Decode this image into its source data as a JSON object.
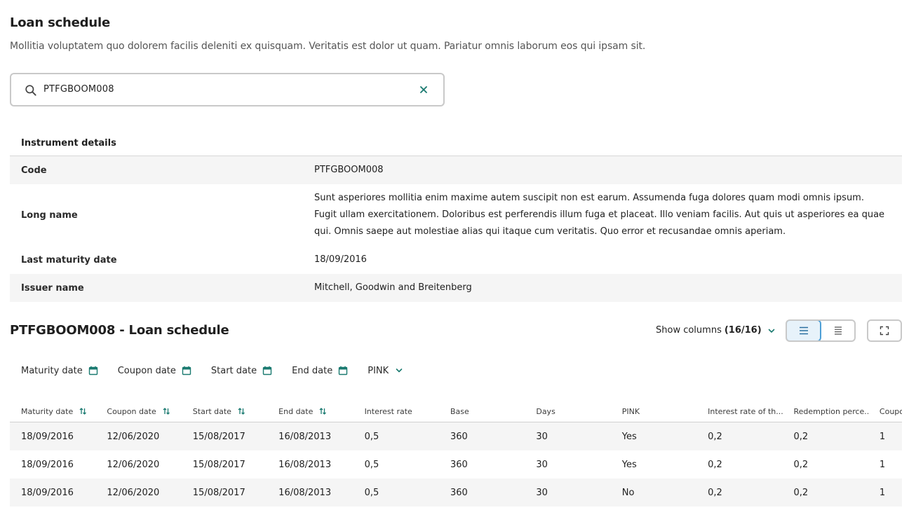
{
  "header": {
    "title": "Loan schedule",
    "description": "Mollitia voluptatem quo dolorem facilis deleniti ex quisquam. Veritatis est dolor ut quam. Pariatur omnis laborum eos qui ipsam sit."
  },
  "search": {
    "value": "PTFGBOOM008",
    "icon": "search-icon",
    "clear_icon": "close-icon"
  },
  "instrument_details": {
    "title": "Instrument details",
    "rows": [
      {
        "label": "Code",
        "value": "PTFGBOOM008"
      },
      {
        "label": "Long name",
        "value": "Sunt asperiores mollitia enim maxime autem suscipit non est earum. Assumenda fuga dolores quam modi omnis ipsum. Fugit ullam exercitationem. Doloribus est perferendis illum fuga et placeat. Illo veniam facilis. Aut quis ut asperiores ea quae qui. Omnis saepe aut molestiae alias qui itaque cum veritatis. Quo error et recusandae omnis aperiam."
      },
      {
        "label": "Last maturity date",
        "value": "18/09/2016"
      },
      {
        "label": "Issuer name",
        "value": "Mitchell, Goodwin and Breitenberg"
      }
    ]
  },
  "schedule": {
    "title": "PTFGBOOM008 - Loan schedule",
    "show_columns_label": "Show columns",
    "show_columns_count": "(16/16)",
    "filters": [
      {
        "label": "Maturity date",
        "icon": "calendar-icon"
      },
      {
        "label": "Coupon date",
        "icon": "calendar-icon"
      },
      {
        "label": "Start date",
        "icon": "calendar-icon"
      },
      {
        "label": "End date",
        "icon": "calendar-icon"
      },
      {
        "label": "PINK",
        "icon": "chevron-down-icon"
      }
    ],
    "columns": [
      "Maturity date",
      "Coupon date",
      "Start date",
      "End date",
      "Interest rate",
      "Base",
      "Days",
      "PINK",
      "Interest rate of th...",
      "Redemption perce...",
      "Coupo"
    ],
    "rows": [
      [
        "18/09/2016",
        "12/06/2020",
        "15/08/2017",
        "16/08/2013",
        "0,5",
        "360",
        "30",
        "Yes",
        "0,2",
        "0,2",
        "1"
      ],
      [
        "18/09/2016",
        "12/06/2020",
        "15/08/2017",
        "16/08/2013",
        "0,5",
        "360",
        "30",
        "Yes",
        "0,2",
        "0,2",
        "1"
      ],
      [
        "18/09/2016",
        "12/06/2020",
        "15/08/2017",
        "16/08/2013",
        "0,5",
        "360",
        "30",
        "No",
        "0,2",
        "0,2",
        "1"
      ]
    ]
  },
  "colors": {
    "accent": "#1a7a70",
    "toggle_active_border": "#4d9fd6",
    "toggle_active_bg": "#e7f2fa",
    "row_alt_bg": "#f5f5f5"
  }
}
